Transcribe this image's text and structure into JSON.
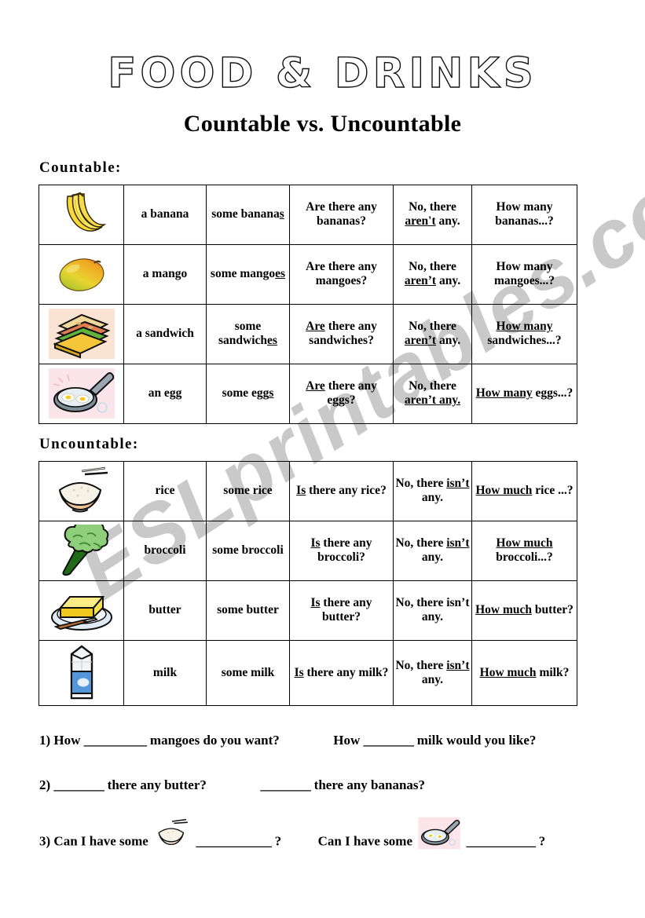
{
  "header": {
    "title": "FOOD & DRINKS",
    "subtitle": "Countable vs. Uncountable"
  },
  "watermark": {
    "text": "ESLprintables.com",
    "color": "#c9c9c9"
  },
  "sections": {
    "countable_label": "Countable:",
    "uncountable_label": "Uncountable:"
  },
  "countable_table": {
    "rows": [
      {
        "image": "bananas-image",
        "singular": "a  banana",
        "plural_prefix": "some banana",
        "plural_underlined": "s",
        "question_pre": "",
        "question_underlined": "",
        "question_rest": "Are there any bananas?",
        "negative_pre": "No, there ",
        "negative_underlined": "aren't",
        "negative_rest": " any.",
        "how_underlined": "",
        "how_plain": "How many bananas...?"
      },
      {
        "image": "mango-image",
        "singular": "a mango",
        "plural_prefix": "some mango",
        "plural_underlined": "es",
        "question_pre": "",
        "question_underlined": "",
        "question_rest": "Are there any mangoes?",
        "negative_pre": "No, there ",
        "negative_underlined": "aren’t",
        "negative_rest": " any.",
        "how_underlined": "",
        "how_plain": "How many mangoes...?"
      },
      {
        "image": "sandwich-image",
        "singular": "a sandwich",
        "plural_prefix": "some sandwich",
        "plural_underlined": "es",
        "question_pre": "",
        "question_underlined": "Are",
        "question_rest": " there any sandwiches?",
        "negative_pre": "No, there ",
        "negative_underlined": "aren’t",
        "negative_rest": " any.",
        "how_underlined": "How many",
        "how_plain": " sandwiches...?"
      },
      {
        "image": "fried-eggs-image",
        "singular": "an egg",
        "plural_prefix": "some egg",
        "plural_underlined": "s",
        "question_pre": "",
        "question_underlined": "Are",
        "question_rest": " there any eggs?",
        "negative_pre": "No, there ",
        "negative_underlined": "aren’t any.",
        "negative_rest": "",
        "how_underlined": "How many",
        "how_plain": " eggs...?"
      }
    ]
  },
  "uncountable_table": {
    "rows": [
      {
        "image": "rice-bowl-image",
        "noun": "rice",
        "some": "some rice",
        "question_underlined": "Is",
        "question_rest": " there any rice?",
        "negative_pre": "No, there ",
        "negative_underlined": "isn’t",
        "negative_rest": " any.",
        "how_underlined": "How much",
        "how_plain": " rice ...?"
      },
      {
        "image": "broccoli-image",
        "noun": "broccoli",
        "some": "some broccoli",
        "question_underlined": "Is",
        "question_rest": " there any broccoli?",
        "negative_pre": "No, there ",
        "negative_underlined": "isn’t",
        "negative_rest": " any.",
        "how_underlined": "How much",
        "how_plain": " broccoli...?"
      },
      {
        "image": "butter-image",
        "noun": "butter",
        "some": "some butter",
        "question_underlined": "Is",
        "question_rest": " there any butter?",
        "negative_pre": "No, there isn’t any.",
        "negative_underlined": "",
        "negative_rest": "",
        "how_underlined": "How much",
        "how_plain": " butter?"
      },
      {
        "image": "milk-carton-image",
        "noun": "milk",
        "some": "some milk",
        "question_underlined": "Is",
        "question_rest": " there any milk?",
        "negative_pre": "No, there ",
        "negative_underlined": "isn’t",
        "negative_rest": " any.",
        "how_underlined": "How much",
        "how_plain": " milk?"
      }
    ]
  },
  "exercises": {
    "one": {
      "number": "1)",
      "part_a_pre": "How",
      "part_a_blank": "__________",
      "part_a_post": "mangoes do you want?",
      "part_b_pre": "How",
      "part_b_blank": "________",
      "part_b_post": "milk would you like?"
    },
    "two": {
      "number": "2)",
      "part_a_blank": "________",
      "part_a_post": "there any butter?",
      "part_b_blank": "________",
      "part_b_post": "there any bananas?"
    },
    "three": {
      "number": "3)",
      "part_a_pre": "Can I have some",
      "part_a_image": "rice-bowl-image",
      "part_a_blank": "____________",
      "part_a_post": "?",
      "part_b_pre": "Can I have some",
      "part_b_image": "fried-eggs-image",
      "part_b_blank": "___________",
      "part_b_post": "?"
    }
  }
}
